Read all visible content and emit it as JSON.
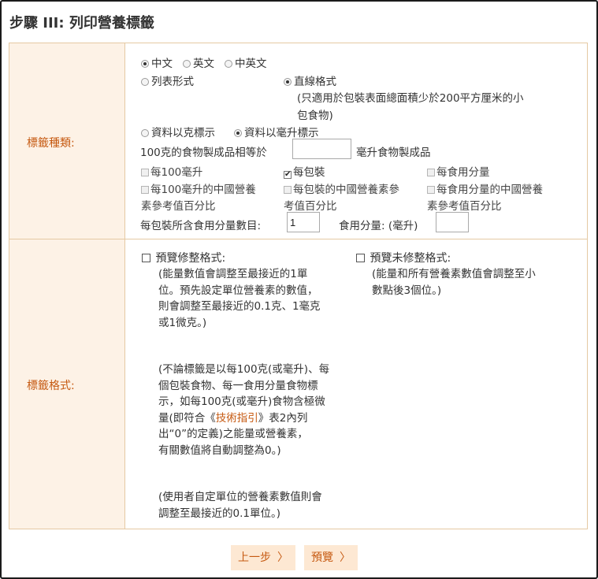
{
  "title": "步驟 III: 列印營養標籤",
  "label_type": {
    "label": "標籤種類:",
    "lang_options": [
      "中文",
      "英文",
      "中英文"
    ],
    "lang_selected": 0,
    "layout_list": "列表形式",
    "layout_linear": "直線格式",
    "linear_note_1": "(只適用於包裝表面總面積少於200平方厘米的小",
    "linear_note_2": "包食物)",
    "unit_gram": "資料以克標示",
    "unit_ml": "資料以毫升標示",
    "equiv_prefix": "100克的食物製成品相等於",
    "equiv_value": "",
    "equiv_suffix": "毫升食物製成品",
    "cb_per100": "每100毫升",
    "cb_perpack": "每包裝",
    "cb_perserving": "每食用分量",
    "cb_nrv100_a": "每100毫升的中國營養",
    "cb_nrv100_b": "素參考值百分比",
    "cb_nrvpack_a": "每包裝的中國營養素參",
    "cb_nrvpack_b": "考值百分比",
    "cb_nrvserv_a": "每食用分量的中國營養",
    "cb_nrvserv_b": "素參考值百分比",
    "servings_label": "每包裝所含食用分量數目:",
    "servings_value": "1",
    "serving_size_label": "食用分量: (毫升)",
    "serving_size_value": ""
  },
  "label_format": {
    "label": "標籤格式:",
    "rounded_title": "預覽修整格式:",
    "rounded_desc": [
      "(能量數值會調整至最接近的1單",
      "位。預先設定單位營養素的數值，",
      "則會調整至最接近的0.1克、1毫克",
      "或1微克。)"
    ],
    "zero_desc": [
      "(不論標籤是以每100克(或毫升)、每",
      "個包裝食物、每一食用分量食物標",
      "示，如每100克(或毫升)食物含極微"
    ],
    "zero_line4_pre": "量(即符合《",
    "zero_link": "技術指引",
    "zero_line4_post": "》表2內列",
    "zero_desc_2": [
      "出“0”的定義)之能量或營養素，",
      "有關數值將自動調整為0。)"
    ],
    "custom_desc": [
      "(使用者自定單位的營養素數值則會",
      "調整至最接近的0.1單位。)"
    ],
    "unrounded_title": "預覽未修整格式:",
    "unrounded_desc": [
      "(能量和所有營養素數值會調整至小",
      "數點後3個位。)"
    ]
  },
  "buttons": {
    "prev": "上一步",
    "preview": "預覽"
  },
  "colors": {
    "accent": "#c65a12",
    "label_bg": "#fdf2e6",
    "border": "#e5c9a3",
    "button_bg": "#fde8d3"
  }
}
